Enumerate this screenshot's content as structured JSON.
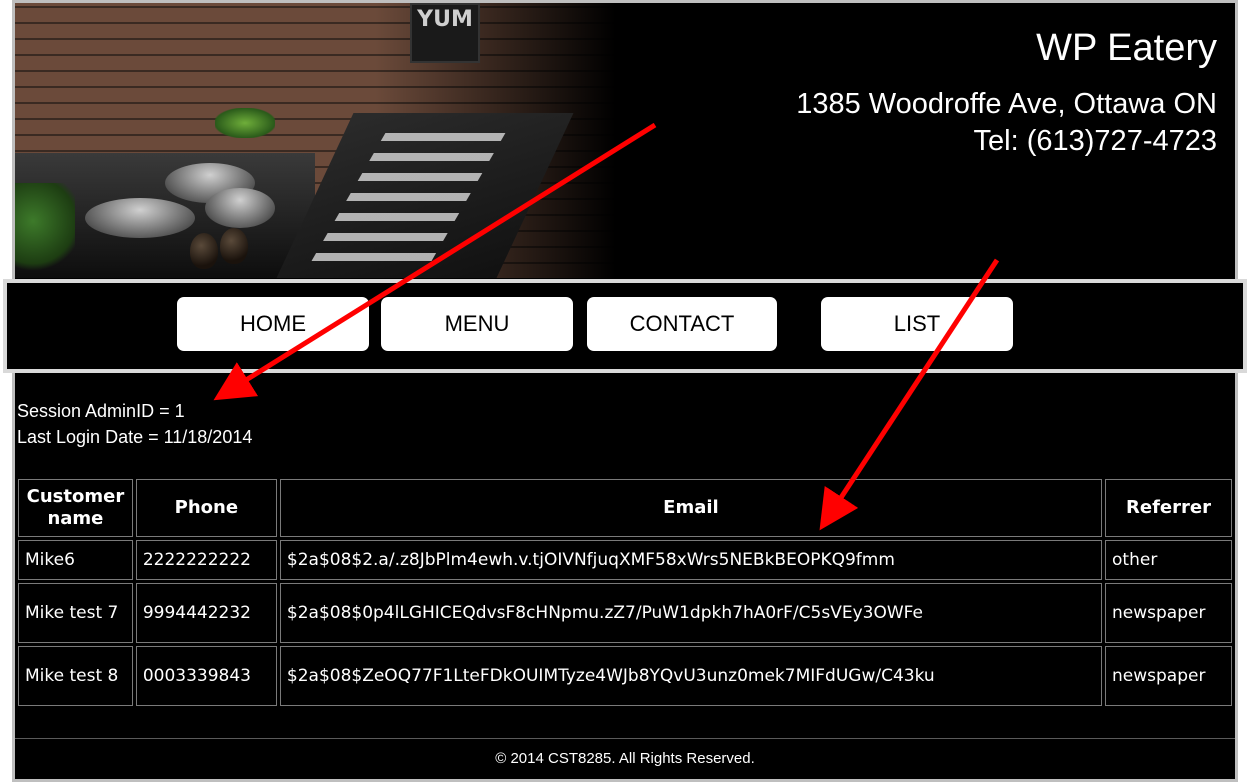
{
  "header": {
    "sign_text": "YUM",
    "business_name": "WP Eatery",
    "address": "1385 Woodroffe Ave, Ottawa ON",
    "phone": "Tel: (613)727-4723"
  },
  "nav": {
    "items": [
      {
        "label": "HOME"
      },
      {
        "label": "MENU"
      },
      {
        "label": "CONTACT"
      },
      {
        "label": "LIST"
      }
    ]
  },
  "session": {
    "admin_line": "Session AdminID = 1",
    "login_line": "Last Login Date = 11/18/2014"
  },
  "table": {
    "columns": [
      "Customer name",
      "Phone",
      "Email",
      "Referrer"
    ],
    "rows": [
      {
        "name": "Mike6",
        "phone": "2222222222",
        "email": "$2a$08$2.a/.z8JbPlm4ewh.v.tjOIVNfjuqXMF58xWrs5NEBkBEOPKQ9fmm",
        "referrer": "other"
      },
      {
        "name": "Mike test 7",
        "phone": "9994442232",
        "email": "$2a$08$0p4lLGHICEQdvsF8cHNpmu.zZ7/PuW1dpkh7hA0rF/C5sVEy3OWFe",
        "referrer": "newspaper"
      },
      {
        "name": "Mike test 8",
        "phone": "0003339843",
        "email": "$2a$08$ZeOQ77F1LteFDkOUIMTyze4WJb8YQvU3unz0mek7MIFdUGw/C43ku",
        "referrer": "newspaper"
      }
    ]
  },
  "footer": {
    "text": "© 2014 CST8285. All Rights Reserved."
  },
  "colors": {
    "background": "#000000",
    "text": "#ffffff",
    "nav_button": "#ffffff",
    "annotation_arrow": "#ff0000"
  }
}
